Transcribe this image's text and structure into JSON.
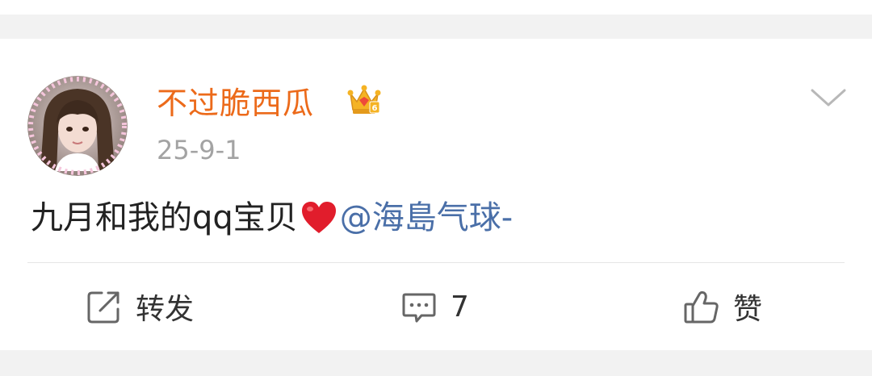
{
  "post": {
    "username": "不过脆西瓜",
    "timestamp": "25-9-1",
    "text_before": "九月和我的qq宝贝",
    "mention": "@海島气球-"
  },
  "actions": {
    "repost_label": "转发",
    "comment_count": "7",
    "like_label": "赞"
  },
  "colors": {
    "username": "#ec6a1a",
    "mention": "#4a6fa8",
    "timestamp": "#a3a3a3",
    "background": "#f2f2f2"
  },
  "icons": {
    "badge": "crown-badge-icon",
    "emoji": "heart-icon",
    "menu": "chevron-down-icon",
    "repost": "share-out-icon",
    "comment": "comment-bubble-icon",
    "like": "thumbs-up-icon"
  }
}
